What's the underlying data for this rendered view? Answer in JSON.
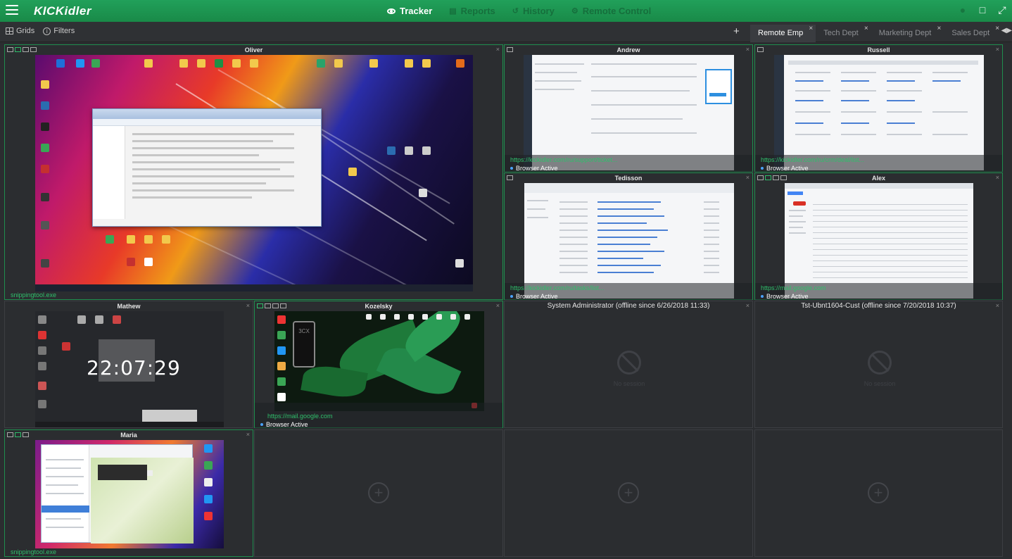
{
  "app": {
    "logo": "KICKidler",
    "nav": [
      {
        "label": "Tracker",
        "active": true
      },
      {
        "label": "Reports",
        "active": false
      },
      {
        "label": "History",
        "active": false
      },
      {
        "label": "Remote Control",
        "active": false
      }
    ],
    "accent_color": "#1f9a52"
  },
  "toolbar": {
    "grids_label": "Grids",
    "filters_label": "Filters",
    "add_tab": "+",
    "tabs": [
      {
        "label": "Remote Emp",
        "active": true
      },
      {
        "label": "Tech Dept",
        "active": false
      },
      {
        "label": "Marketing Dept",
        "active": false
      },
      {
        "label": "Sales Dept",
        "active": false
      }
    ]
  },
  "cells": {
    "oliver": {
      "name": "Oliver",
      "url": "snippingtool.exe"
    },
    "andrew": {
      "name": "Andrew",
      "url": "https://kickidler.com/ru/support/ticket...",
      "status": "Browser Active"
    },
    "russell": {
      "name": "Russell",
      "url": "https://kickidler.com/ru/crm/deal/list...",
      "status": "Browser Active"
    },
    "tedisson": {
      "name": "Tedisson",
      "url": "https://kickidler.com/ru/tasks/list...",
      "status": "Browser Active"
    },
    "alex": {
      "name": "Alex",
      "url": "https://mail.google.com",
      "status": "Browser Active"
    },
    "mathew": {
      "name": "Mathew",
      "clock": "22:07:29"
    },
    "kozelsky": {
      "name": "Kozelsky",
      "url": "https://mail.google.com",
      "status": "Browser Active",
      "phone_label": "3CX"
    },
    "sysadmin": {
      "name": "System Administrator (offline since 6/26/2018 11:33)",
      "no_session": "No session"
    },
    "tstubnt": {
      "name": "Tst-Ubnt1604-Cust (offline since 7/20/2018 10:37)",
      "no_session": "No session"
    },
    "maria": {
      "name": "Maria",
      "url": "snippingtool.exe"
    }
  },
  "add_slot_symbol": "+"
}
